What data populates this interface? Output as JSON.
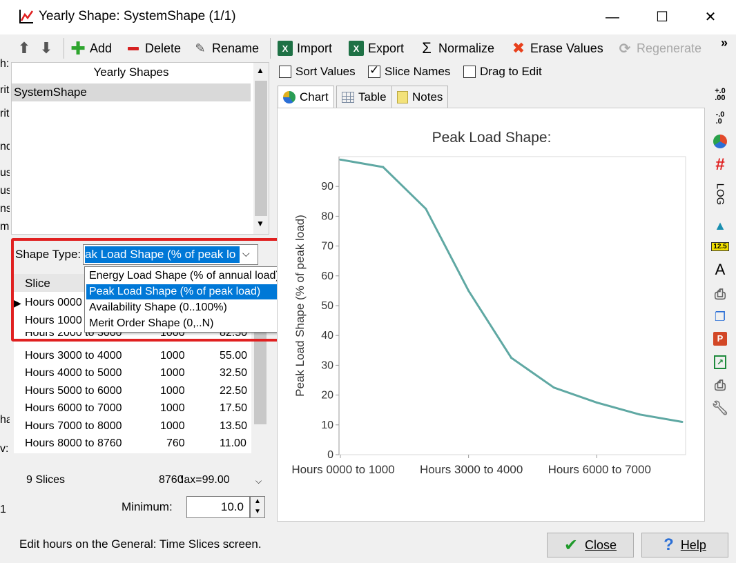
{
  "window": {
    "title": "Yearly Shape: SystemShape (1/1)",
    "controls": {
      "minimize": "—",
      "maximize": "☐",
      "close": "✕"
    }
  },
  "toolbar": {
    "add": "Add",
    "delete": "Delete",
    "rename": "Rename",
    "import": "Import",
    "export": "Export",
    "normalize": "Normalize",
    "erase_values": "Erase Values",
    "regenerate": "Regenerate",
    "more": "»"
  },
  "shapes_list": {
    "header": "Yearly Shapes",
    "items": [
      "SystemShape"
    ],
    "selected": "SystemShape"
  },
  "background_fragments": [
    "h:",
    "rit",
    "rit",
    "nd",
    "us",
    "us",
    "ns",
    "m",
    "ha",
    "v:",
    "1"
  ],
  "shape_type": {
    "label": "Shape Type:",
    "visible_value": "ak Load Shape (% of peak lo",
    "options": [
      "Energy Load Shape (% of annual load)",
      "Peak Load Shape (% of peak load)",
      "Availability Shape (0..100%)",
      "Merit Order Shape (0,..N)"
    ],
    "selected_index": 1
  },
  "slices_table": {
    "header_slice": "Slice",
    "partial_rows": [
      {
        "slice": "Hours 0000"
      },
      {
        "slice": "Hours 1000"
      }
    ],
    "cut_row": {
      "slice": "Hours 2000 to 3000",
      "hours": "1000",
      "value": "82.50"
    },
    "rows": [
      {
        "slice": "Hours 3000 to 4000",
        "hours": "1000",
        "value": "55.00"
      },
      {
        "slice": "Hours 4000 to 5000",
        "hours": "1000",
        "value": "32.50"
      },
      {
        "slice": "Hours 5000 to 6000",
        "hours": "1000",
        "value": "22.50"
      },
      {
        "slice": "Hours 6000 to 7000",
        "hours": "1000",
        "value": "17.50"
      },
      {
        "slice": "Hours 7000 to 8000",
        "hours": "1000",
        "value": "13.50"
      },
      {
        "slice": "Hours 8000 to 8760",
        "hours": "760",
        "value": "11.00"
      }
    ],
    "footer_slices": "9 Slices",
    "footer_hours": "8760",
    "footer_max": "Max=99.00"
  },
  "minimum": {
    "label": "Minimum:",
    "value": "10.0"
  },
  "options": {
    "sort_values": {
      "label": "Sort Values",
      "checked": false
    },
    "slice_names": {
      "label": "Slice Names",
      "checked": true
    },
    "drag_to_edit": {
      "label": "Drag to Edit",
      "checked": false
    }
  },
  "tabs": {
    "chart": "Chart",
    "table": "Table",
    "notes": "Notes"
  },
  "side_icons": {
    "log": "LOG",
    "value_badge": "12.5"
  },
  "status_text": "Edit hours on the General: Time Slices screen.",
  "buttons": {
    "close": "Close",
    "help": "Help"
  },
  "colors": {
    "series": "#5fa8a3",
    "accent": "#0078d7",
    "highlight_border": "#e02020"
  },
  "chart_data": {
    "type": "line",
    "title": "Peak Load Shape:",
    "ylabel": "Peak Load Shape (% of peak load)",
    "xlabel": "",
    "x_tick_labels": [
      "Hours 0000 to 1000",
      "Hours 3000 to 4000",
      "Hours 6000 to 7000"
    ],
    "y_ticks": [
      0,
      10,
      20,
      30,
      40,
      50,
      60,
      70,
      80,
      90
    ],
    "ylim": [
      0,
      100
    ],
    "categories": [
      "Hours 0000 to 1000",
      "Hours 1000 to 2000",
      "Hours 2000 to 3000",
      "Hours 3000 to 4000",
      "Hours 4000 to 5000",
      "Hours 5000 to 6000",
      "Hours 6000 to 7000",
      "Hours 7000 to 8000",
      "Hours 8000 to 8760"
    ],
    "series": [
      {
        "values": [
          99.0,
          96.5,
          82.5,
          55.0,
          32.5,
          22.5,
          17.5,
          13.5,
          11.0
        ]
      }
    ],
    "grid": false
  }
}
